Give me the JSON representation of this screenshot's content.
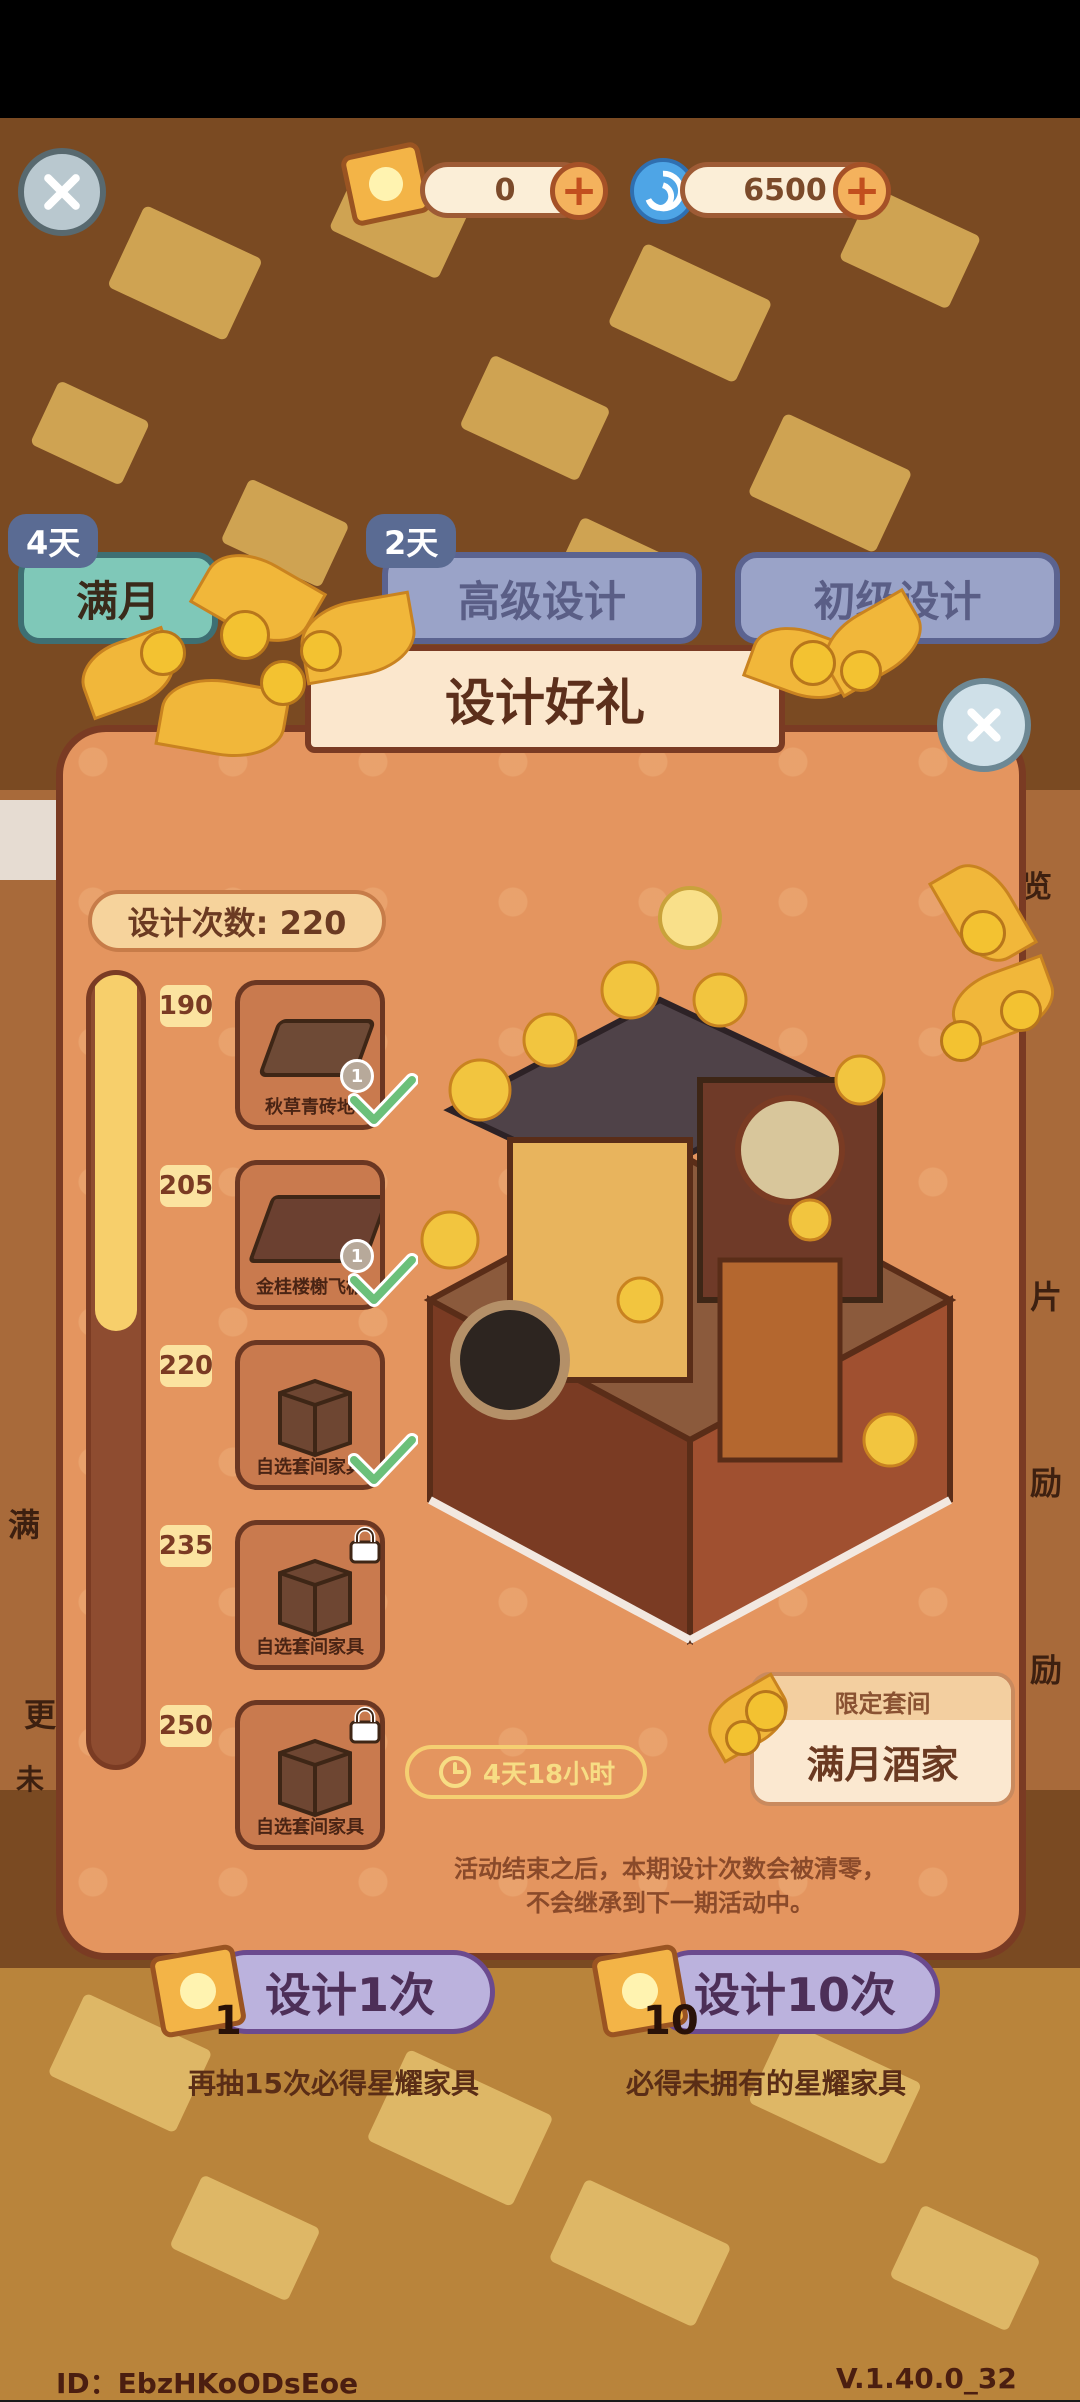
{
  "top_bar": {
    "ticket_count": "0",
    "gem_count": "6500",
    "plus_symbol": "+"
  },
  "background_tabs": {
    "tab1": {
      "days": "4天",
      "label": "满月"
    },
    "tab2": {
      "days": "2天",
      "label": "高级设计"
    },
    "tab3": {
      "label": "初级设计"
    }
  },
  "side_fragments": {
    "right": [
      "览",
      "片",
      "励",
      "励"
    ],
    "left": [
      "满",
      "更",
      "未"
    ]
  },
  "modal": {
    "title": "设计好礼",
    "design_count": "设计次数: 220",
    "progress": 0.45,
    "milestones": [
      {
        "threshold": "190",
        "label": "秋草青砖地",
        "qty": "1",
        "status": "claimed"
      },
      {
        "threshold": "205",
        "label": "金桂楼榭飞檐",
        "qty": "1",
        "status": "claimed"
      },
      {
        "threshold": "220",
        "label": "自选套间家具",
        "qty": "",
        "status": "claimed"
      },
      {
        "threshold": "235",
        "label": "自选套间家具",
        "qty": "",
        "status": "locked"
      },
      {
        "threshold": "250",
        "label": "自选套间家具",
        "qty": "",
        "status": "locked"
      }
    ],
    "timer": "4天18小时",
    "suite_tag": "限定套间",
    "suite_name": "满月酒家",
    "notice_line1": "活动结束之后，本期设计次数会被清零，",
    "notice_line2": "不会继承到下一期活动中。"
  },
  "bottom": {
    "design_once": "设计1次",
    "design_once_cost": "1",
    "design_once_caption": "再抽15次必得星耀家具",
    "design_ten": "设计10次",
    "design_ten_cost": "10",
    "design_ten_caption": "必得未拥有的星耀家具"
  },
  "footer": {
    "user_id": "ID：EbzHKoODsEoe",
    "version": "V.1.40.0_32"
  },
  "colors": {
    "modal_bg": "#e4955f",
    "border_brown": "#7a3b23",
    "progress_fill": "#f7cf6b",
    "check_green": "#6cc07a"
  }
}
